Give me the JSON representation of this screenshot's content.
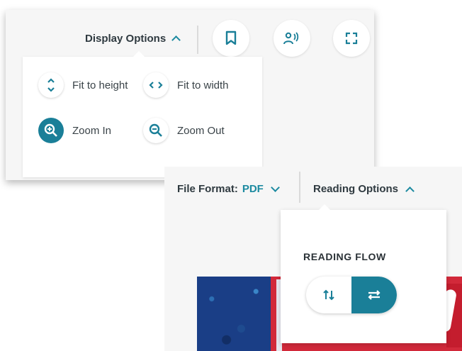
{
  "display_options": {
    "label": "Display Options",
    "fit_to_height": "Fit to height",
    "fit_to_width": "Fit to width",
    "zoom_in": "Zoom In",
    "zoom_out": "Zoom Out"
  },
  "toolbar_icons": [
    "bookmark-icon",
    "audio-speaker-icon",
    "fullscreen-icon"
  ],
  "file_format": {
    "label": "File Format:",
    "value": "PDF"
  },
  "reading_options": {
    "label": "Reading Options",
    "heading": "READING FLOW",
    "selected": "horizontal"
  },
  "colors": {
    "accent": "#1a7f98",
    "text": "#2f3a40"
  }
}
